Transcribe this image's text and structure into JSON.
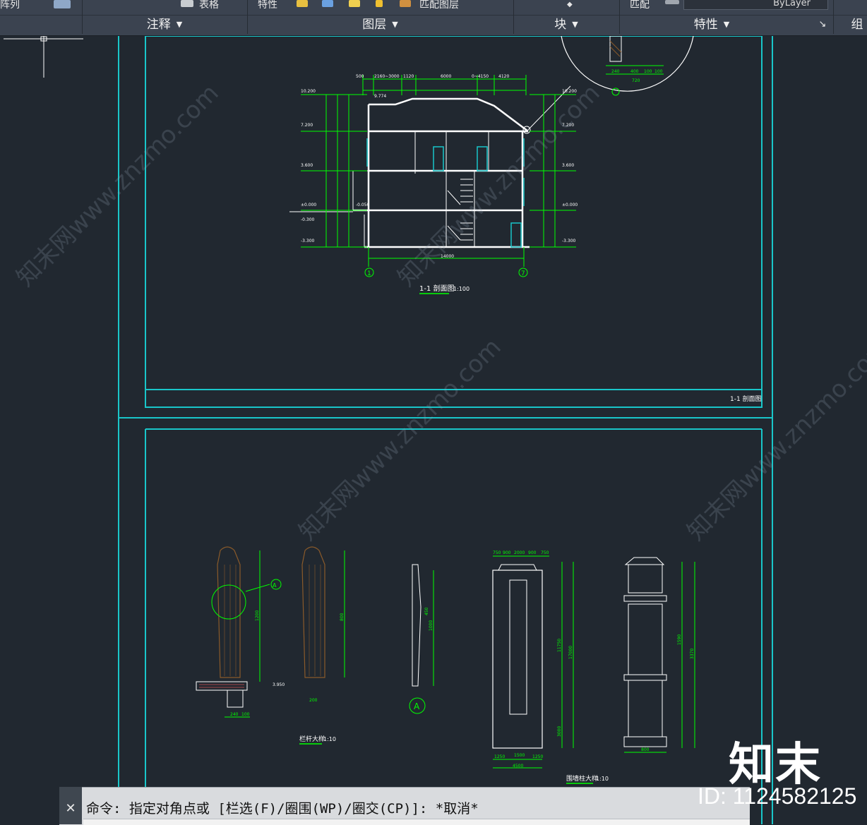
{
  "ribbon": {
    "top_texts": {
      "array": "阵列",
      "table": "表格",
      "props": "特性",
      "match_layer": "匹配图层",
      "match": "匹配",
      "bylayer": "ByLayer"
    },
    "panels": [
      {
        "label": "注释"
      },
      {
        "label": "图层"
      },
      {
        "label": "块"
      },
      {
        "label": "特性"
      },
      {
        "label": "组"
      }
    ]
  },
  "drawing": {
    "section_title": "1-1 剖面图",
    "section_scale": "1:100",
    "title_block_label": "1-1 剖面图",
    "railing_title": "栏杆大样",
    "railing_scale": "1:10",
    "pillar_title": "围墙柱大样",
    "pillar_scale": "1:10",
    "axis_left": "1",
    "axis_right": "7",
    "detail_marker": "A",
    "dims": {
      "overall": "14000",
      "top": [
        "500",
        "2160~3000",
        "1120",
        "6000",
        "0~4150",
        "4120"
      ],
      "detail": [
        "240",
        "400",
        "100",
        "100",
        "720"
      ],
      "elev_left": [
        "10.200",
        "7.200",
        "3.600",
        "±0.000",
        "-0.300",
        "-3.300"
      ],
      "elev_right": [
        "10.200",
        "7.200",
        "3.600",
        "±0.000",
        "-3.300"
      ],
      "ridge": "9.774",
      "step": "-0.050",
      "pillar_bottom": [
        "1250",
        "1500",
        "1250"
      ],
      "pillar_total": "4500",
      "pillar_top": [
        "750",
        "900",
        "2000",
        "900",
        "750"
      ],
      "pillar_height": "17000",
      "pillar_mid": "11750",
      "pillar_base": "3000",
      "cap_width": "800",
      "railing_height": "1200",
      "railing_inner": "800",
      "railing_elev": "3.950",
      "railing_base": "200",
      "post_height": "1000",
      "post_inner": "450",
      "total_right": "3370",
      "sub_right": "1590",
      "left_dim": "240",
      "left_dim2": "100"
    }
  },
  "command": {
    "close_icon": "close-icon",
    "text": "命令: 指定对角点或 [栏选(F)/圈围(WP)/圈交(CP)]: *取消*"
  },
  "brand": {
    "logo": "知末",
    "id": "ID: 1124582125"
  },
  "watermark": "知末网www.znzmo.com",
  "colors": {
    "frame": "#19c6c9",
    "line": "#ffffff",
    "dim": "#00ff00",
    "hatch": "#8a5a2a"
  }
}
